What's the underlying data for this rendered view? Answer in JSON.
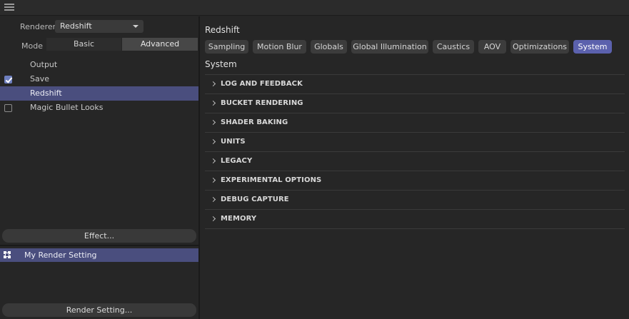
{
  "header": {
    "menu_icon": "hamburger-icon"
  },
  "left_panel": {
    "renderer_label": "Renderer",
    "renderer_value": "Redshift",
    "mode_label": "Mode",
    "mode_options": [
      "Basic",
      "Advanced"
    ],
    "mode_selected": "Advanced",
    "items": [
      {
        "label": "Output",
        "checkbox": "none",
        "selected": false
      },
      {
        "label": "Save",
        "checkbox": "checked",
        "selected": false
      },
      {
        "label": "Redshift",
        "checkbox": "none",
        "selected": true
      },
      {
        "label": "Magic Bullet Looks",
        "checkbox": "unchecked",
        "selected": false
      }
    ],
    "effect_button": "Effect...",
    "render_setting_name": "My Render Setting",
    "render_setting_button": "Render Setting..."
  },
  "right_panel": {
    "title": "Redshift",
    "tabs": [
      "Sampling",
      "Motion Blur",
      "Globals",
      "Global Illumination",
      "Caustics",
      "AOV",
      "Optimizations",
      "System"
    ],
    "active_tab": "System",
    "section_title": "System",
    "sections": [
      "LOG AND FEEDBACK",
      "BUCKET RENDERING",
      "SHADER BAKING",
      "UNITS",
      "LEGACY",
      "EXPERIMENTAL OPTIONS",
      "DEBUG CAPTURE",
      "MEMORY"
    ]
  },
  "colors": {
    "accent": "#5b61ad",
    "selection": "#4a4e7e",
    "background": "#262626"
  }
}
